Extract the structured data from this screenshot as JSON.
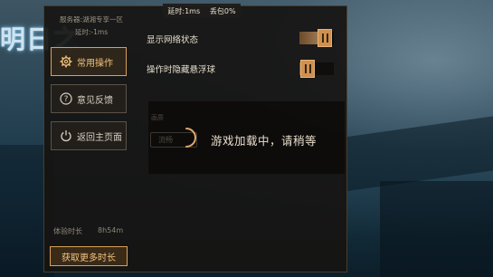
{
  "top_status": {
    "latency": "延时:1ms",
    "packet_loss": "丢包0%"
  },
  "background": {
    "logo_text": "明日之"
  },
  "server": {
    "name": "服务器:湖湘专享一区",
    "latency": "延时:-1ms"
  },
  "nav": [
    {
      "label": "常用操作",
      "icon": "gear-icon",
      "active": true
    },
    {
      "label": "意见反馈",
      "icon": "question-icon",
      "active": false
    },
    {
      "label": "返回主页面",
      "icon": "power-icon",
      "active": false
    }
  ],
  "settings": [
    {
      "label": "显示网络状态",
      "enabled": true
    },
    {
      "label": "操作时隐藏悬浮球",
      "enabled": false
    }
  ],
  "experience": {
    "label": "体验时长",
    "value": "8h54m"
  },
  "more_time_button": "获取更多时长",
  "loading": {
    "text": "游戏加载中，请稍等",
    "ghost_label": "画质",
    "ghost_button": "流畅"
  },
  "colors": {
    "accent": "#d7a15a",
    "panel": "#161412",
    "toggle_knob": "#cf9150"
  }
}
